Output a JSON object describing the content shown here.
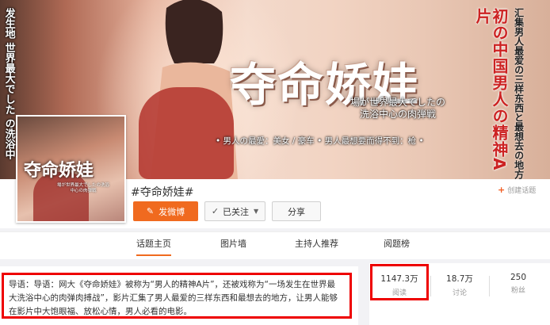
{
  "banner": {
    "left_vertical": "发生地\n世界最大でした\nの洗浴中",
    "title": "夺命娇娃",
    "subtitle_line1": "場が世界最大でしたの",
    "subtitle_line2": "洗浴中心の肉弾戦",
    "tagline": "• 男人の最愛：美女 / 豪车   • 男人最想要而得不到：枪 •",
    "right_vertical_main": "初の中国男人の精神A片",
    "right_vertical_side": "汇集男人最爱の三样东西と最想去の地方"
  },
  "avatar": {
    "title": "夺命娇娃",
    "subtitle": "場が世界最大でしたの洗浴中心の肉弾戦"
  },
  "topic": {
    "name": "#夺命娇娃#",
    "create_label": "创建话题",
    "post_label": "发微博",
    "follow_label": "已关注",
    "share_label": "分享"
  },
  "tabs": [
    "话题主页",
    "图片墙",
    "主持人推荐",
    "阅题榜"
  ],
  "intro": {
    "text": "导语：导语：网大《夺命娇娃》被称为“男人的精神A片”，还被戏称为“一场发生在世界最大洗浴中心的肉弹肉搏战”，影片汇集了男人最爱的三样东西和最想去的地方，让男人能够在影片中大饱眼福、放松心情，男人必看的电影。"
  },
  "stats": [
    {
      "value": "1147.3万",
      "label": "阅读"
    },
    {
      "value": "18.7万",
      "label": "讨论"
    },
    {
      "value": "250",
      "label": "粉丝"
    }
  ],
  "colors": {
    "accent": "#f06a1f",
    "highlight": "#ee0000"
  }
}
